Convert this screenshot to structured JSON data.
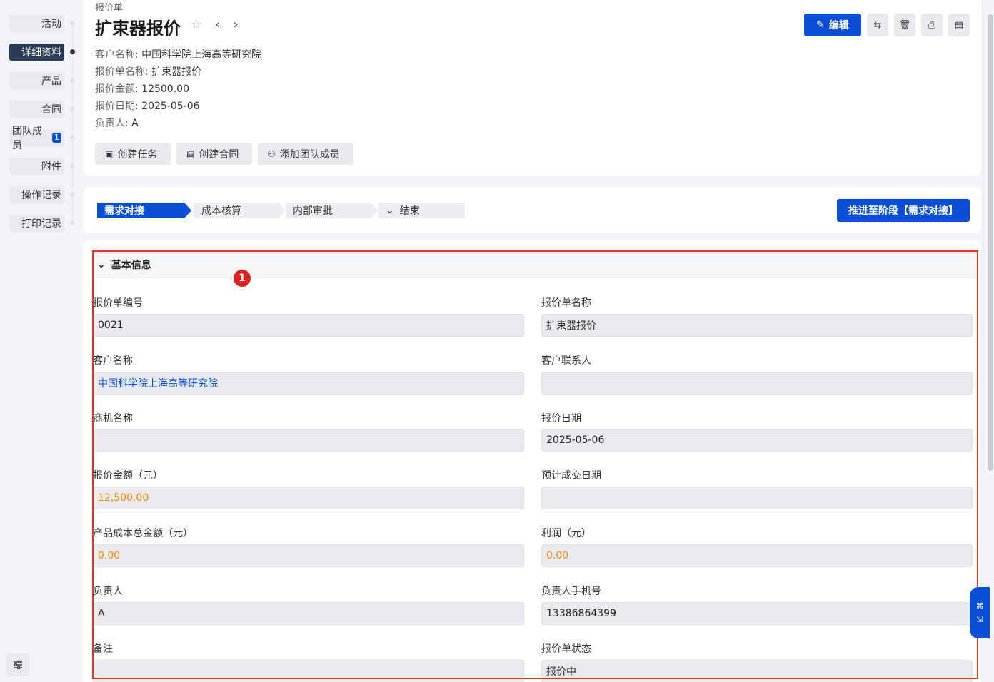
{
  "anchors": [
    {
      "label": "活动",
      "active": false
    },
    {
      "label": "详细资料",
      "active": true
    },
    {
      "label": "产品",
      "active": false
    },
    {
      "label": "合同",
      "active": false
    },
    {
      "label": "团队成员",
      "active": false,
      "badge": "1"
    },
    {
      "label": "附件",
      "active": false
    },
    {
      "label": "操作记录",
      "active": false
    },
    {
      "label": "打印记录",
      "active": false
    }
  ],
  "header": {
    "crumb": "报价单",
    "title": "扩束器报价",
    "meta": [
      {
        "k": "客户名称:",
        "v": "中国科学院上海高等研究院"
      },
      {
        "k": "报价单名称:",
        "v": "扩束器报价"
      },
      {
        "k": "报价金额:",
        "v": "12500.00"
      },
      {
        "k": "报价日期:",
        "v": "2025-05-06"
      },
      {
        "k": "负责人:",
        "v": "A"
      }
    ],
    "actions": [
      "创建任务",
      "创建合同",
      "添加团队成员"
    ],
    "edit_label": "编辑"
  },
  "stages": {
    "items": [
      "需求对接",
      "成本核算",
      "内部审批",
      "结束"
    ],
    "advance_label": "推进至阶段【需求对接】"
  },
  "section": {
    "title": "基本信息",
    "marker": "1",
    "fields": [
      {
        "label": "报价单编号",
        "value": "0021"
      },
      {
        "label": "报价单名称",
        "value": "扩束器报价"
      },
      {
        "label": "客户名称",
        "value": "中国科学院上海高等研究院"
      },
      {
        "label": "客户联系人",
        "value": ""
      },
      {
        "label": "商机名称",
        "value": ""
      },
      {
        "label": "报价日期",
        "value": "2025-05-06"
      },
      {
        "label": "报价金额（元）",
        "value": "12,500.00"
      },
      {
        "label": "预计成交日期",
        "value": ""
      },
      {
        "label": "产品成本总金额（元）",
        "value": "0.00"
      },
      {
        "label": "利润（元）",
        "value": "0.00"
      },
      {
        "label": "负责人",
        "value": "A"
      },
      {
        "label": "负责人手机号",
        "value": "13386864399"
      },
      {
        "label": "备注",
        "value": ""
      },
      {
        "label": "报价单状态",
        "value": "报价中"
      }
    ]
  },
  "colors": {
    "primary": "#0a4fd6",
    "amount": "#f08a00",
    "highlight_box": "#e8321a"
  }
}
